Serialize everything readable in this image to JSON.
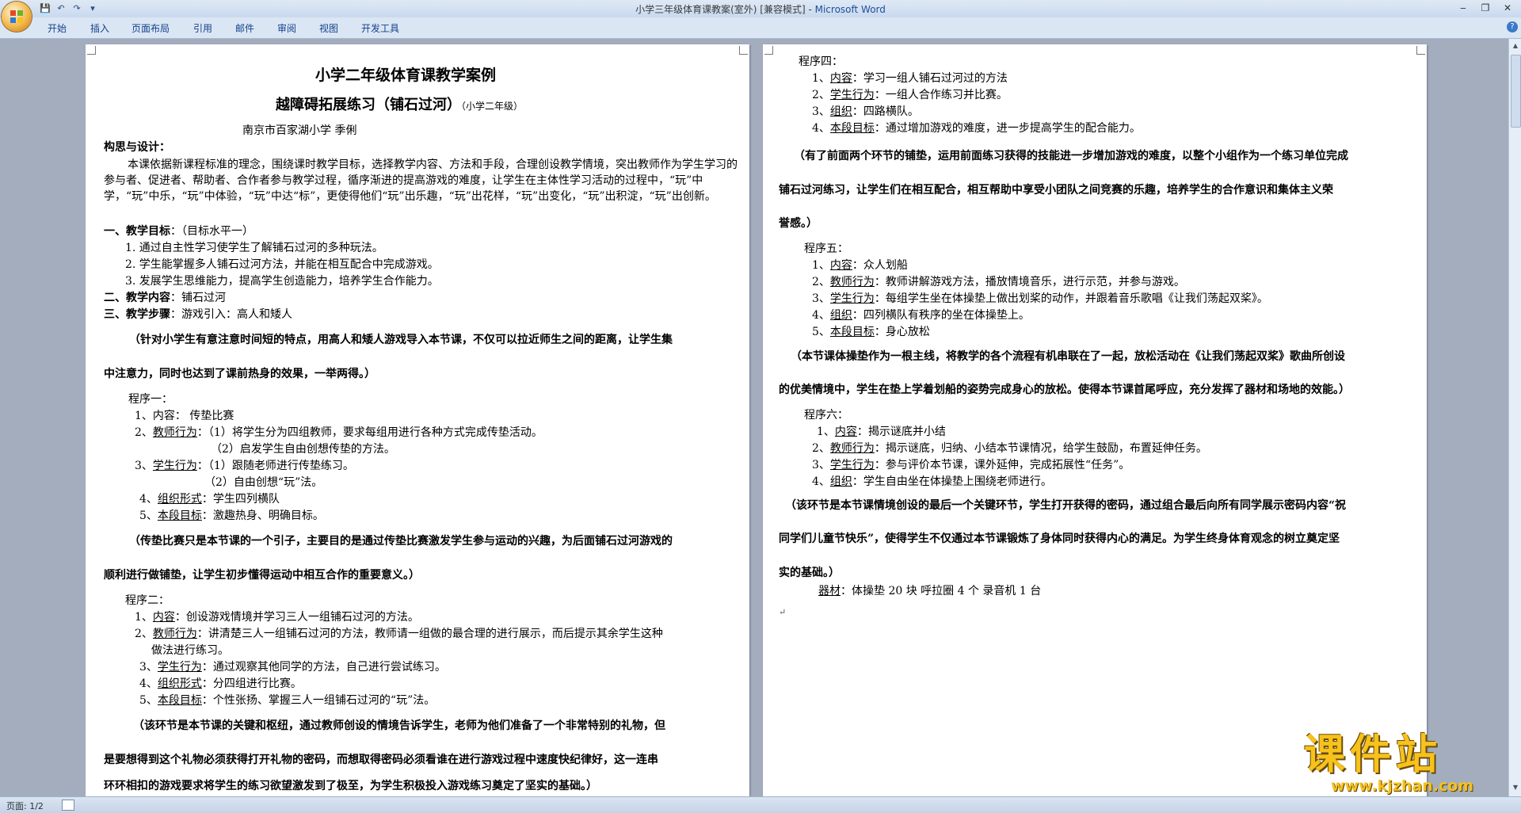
{
  "window": {
    "title_doc": "小学三年级体育课教案(室外) [兼容模式] - ",
    "title_app": "Microsoft Word"
  },
  "ribbon": {
    "tabs": [
      "开始",
      "插入",
      "页面布局",
      "引用",
      "邮件",
      "审阅",
      "视图",
      "开发工具"
    ]
  },
  "status": {
    "page": "页面: 1/2"
  },
  "watermark": {
    "big": "课件站",
    "url": "www.kjzhan.com"
  },
  "page1": {
    "title": "小学二年级体育课教学案例",
    "subtitle": "越障碍拓展练习（铺石过河）",
    "subtitle_small": "（小学二年级）",
    "author": "南京市百家湖小学   季俐",
    "concept_head": "构思与设计：",
    "concept_body": "本课依据新课程标准的理念，围绕课时教学目标，选择教学内容、方法和手段，合理创设教学情境，突出教师作为学生学习的参与者、促进者、帮助者、合作者参与教学过程，循序渐进的提高游戏的难度，让学生在主体性学习活动的过程中，“玩”中学，“玩”中乐，“玩”中体验，“玩”中达“标”，更使得他们“玩”出乐趣，“玩”出花样，“玩”出变化，“玩”出积淀，“玩”出创新。",
    "goal_head": "一、教学目标",
    "goal_level": "：（目标水平一）",
    "goals": [
      "1.   通过自主性学习使学生了解铺石过河的多种玩法。",
      "2.   学生能掌握多人铺石过河方法，并能在相互配合中完成游戏。",
      "3.   发展学生思维能力，提高学生创造能力，培养学生合作能力。"
    ],
    "content_head": "二、教学内容",
    "content_val": "：铺石过河",
    "steps_head": "三、教学步骤",
    "steps_val": "：游戏引入：高人和矮人",
    "note1_a": "（针对小学生有意注意时间短的特点，用高人和矮人游戏导入本节课，不仅可以拉近师生之间的距离，让学生集",
    "note1_b": "中注意力，同时也达到了课前热身的效果，一举两得。）",
    "p1_head": "程序一：",
    "p1_l1a": "1、内容：     ",
    "p1_l1b": "传垫比赛",
    "p1_l2a": "2、",
    "p1_l2u": "教师行为",
    "p1_l2b": "：（1）将学生分为四组教师，要求每组用进行各种方式完成传垫活动。",
    "p1_l3": "（2）启发学生自由创想传垫的方法。",
    "p1_l4a": "3、",
    "p1_l4u": "学生行为",
    "p1_l4b": "：（1）跟随老师进行传垫练习。",
    "p1_l5": "（2）自由创想“玩”法。",
    "p1_l6a": "4、",
    "p1_l6u": "组织形式",
    "p1_l6b": "：学生四列横队",
    "p1_l7a": "5、",
    "p1_l7u": "本段目标",
    "p1_l7b": "：激趣热身、明确目标。",
    "note2_a": "（传垫比赛只是本节课的一个引子，主要目的是通过传垫比赛激发学生参与运动的兴趣，为后面铺石过河游戏的",
    "note2_b": "顺利进行做铺垫，让学生初步懂得运动中相互合作的重要意义。）",
    "p2_head": "程序二：",
    "p2_l1a": "1、",
    "p2_l1u": "内容",
    "p2_l1b": "：创设游戏情境并学习三人一组铺石过河的方法。",
    "p2_l2a": "2、",
    "p2_l2u": "教师行为",
    "p2_l2b": "：讲清楚三人一组铺石过河的方法，教师请一组做的最合理的进行展示，而后提示其余学生这种",
    "p2_l2c": "做法进行练习。",
    "p2_l3a": "3、",
    "p2_l3u": "学生行为",
    "p2_l3b": "：通过观察其他同学的方法，自己进行尝试练习。",
    "p2_l4a": "4、",
    "p2_l4u": "组织形式",
    "p2_l4b": "：分四组进行比赛。",
    "p2_l5a": "5、",
    "p2_l5u": "本段目标",
    "p2_l5b": "：个性张扬、掌握三人一组铺石过河的“玩”法。",
    "note3_a": "（该环节是本节课的关键和枢纽，通过教师创设的情境告诉学生，老师为他们准备了一个非常特别的礼物，但",
    "note3_b": "是要想得到这个礼物必须获得打开礼物的密码，而想取得密码必须看谁在进行游戏过程中速度快纪律好，这一连串",
    "note3_c": "环环相扣的游戏要求将学生的练习欲望激发到了极至，为学生积极投入游戏练习奠定了坚实的基础。）"
  },
  "page2": {
    "p4_head": "程序四：",
    "p4_l1a": "1、",
    "p4_l1u": "内容",
    "p4_l1b": "：学习一组人铺石过河过的方法",
    "p4_l2a": "2、",
    "p4_l2u": "学生行为",
    "p4_l2b": "：一组人合作练习并比赛。",
    "p4_l3a": "3、",
    "p4_l3u": "组织",
    "p4_l3b": "：四路横队。",
    "p4_l4a": "4、",
    "p4_l4u": "本段目标",
    "p4_l4b": "：通过增加游戏的难度，进一步提高学生的配合能力。",
    "note4_a": "（有了前面两个环节的铺垫，运用前面练习获得的技能进一步增加游戏的难度，以整个小组作为一个练习单位完成",
    "note4_b": "铺石过河练习，让学生们在相互配合，相互帮助中享受小团队之间竞赛的乐趣，培养学生的合作意识和集体主义荣",
    "note4_c": "誉感。）",
    "p5_head": "程序五：",
    "p5_l1a": "1、",
    "p5_l1u": "内容",
    "p5_l1b": "：众人划船",
    "p5_l2a": "2、",
    "p5_l2u": "教师行为",
    "p5_l2b": "：教师讲解游戏方法，播放情境音乐，进行示范，并参与游戏。",
    "p5_l3a": "3、",
    "p5_l3u": "学生行为",
    "p5_l3b": "：每组学生坐在体操垫上做出划桨的动作，并跟着音乐歌唱《让我们荡起双桨》。",
    "p5_l4a": "4、",
    "p5_l4u": "组织",
    "p5_l4b": "：四列横队有秩序的坐在体操垫上。",
    "p5_l5a": "5、",
    "p5_l5u": "本段目标",
    "p5_l5b": "：身心放松",
    "note5_a": "（本节课体操垫作为一根主线，将教学的各个流程有机串联在了一起，放松活动在《让我们荡起双桨》歌曲所创设",
    "note5_b": "的优美情境中，学生在垫上学着划船的姿势完成身心的放松。使得本节课首尾呼应，充分发挥了器材和场地的效能。）",
    "p6_head": "程序六：",
    "p6_l1a": "1、",
    "p6_l1u": "内容",
    "p6_l1b": "：揭示谜底并小结",
    "p6_l2a": "2、",
    "p6_l2u": "教师行为",
    "p6_l2b": "：揭示谜底，归纳、小结本节课情况，给学生鼓励，布置延伸任务。",
    "p6_l3a": "3、",
    "p6_l3u": "学生行为",
    "p6_l3b": "：参与评价本节课，课外延伸，完成拓展性“任务”。",
    "p6_l4a": "4、",
    "p6_l4u": "组织",
    "p6_l4b": "：学生自由坐在体操垫上围绕老师进行。",
    "note6_a": "（该环节是本节课情境创设的最后一个关键环节，学生打开获得的密码，通过组合最后向所有同学展示密码内容“祝",
    "note6_b": "同学们儿童节快乐”，使得学生不仅通过本节课锻炼了身体同时获得内心的满足。为学生终身体育观念的树立奠定坚",
    "note6_c": "实的基础。）",
    "equip_u": "器材",
    "equip_b": "：体操垫 20 块     呼拉圈 4 个      录音机 1 台"
  }
}
